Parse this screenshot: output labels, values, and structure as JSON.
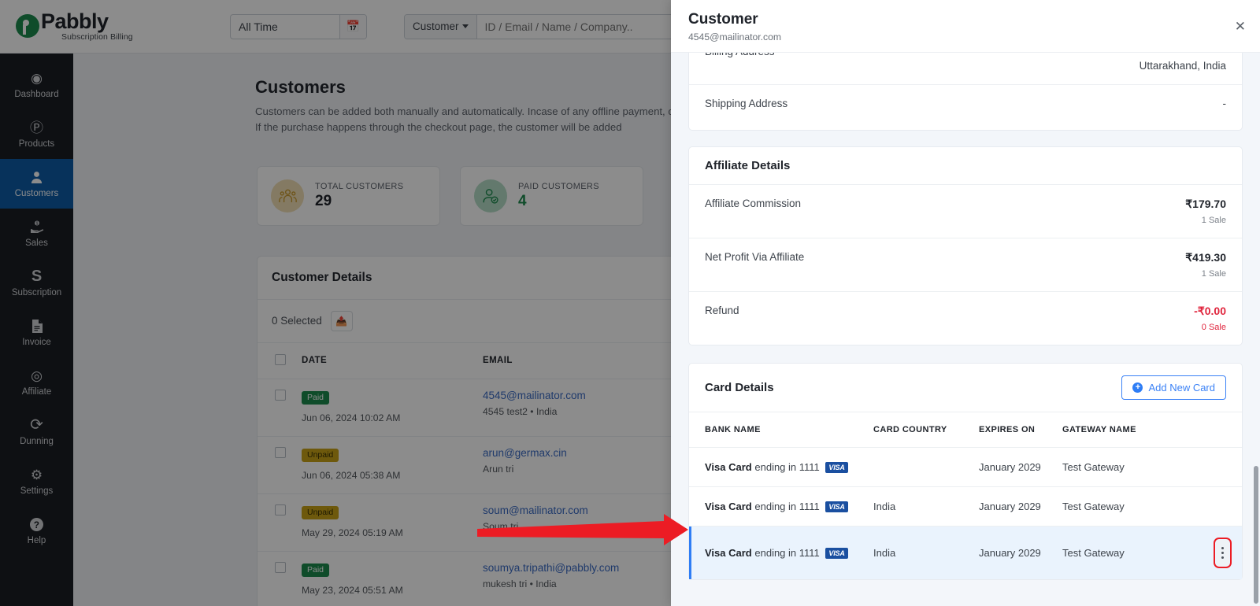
{
  "brand": {
    "name": "Pabbly",
    "subtitle": "Subscription Billing"
  },
  "toolbar": {
    "date_filter_value": "All Time",
    "calendar_icon": "calendar-icon",
    "search_kind": "Customer",
    "search_placeholder": "ID / Email / Name / Company..",
    "search_value": "",
    "search_icon": "search-icon"
  },
  "sidebar": {
    "items": [
      {
        "label": "Dashboard",
        "icon": "speedometer-icon",
        "glyph": "◕",
        "active": false
      },
      {
        "label": "Products",
        "icon": "product-p-icon",
        "glyph": "Ⓟ",
        "active": false
      },
      {
        "label": "Customers",
        "icon": "person-icon",
        "glyph": "👤",
        "active": true
      },
      {
        "label": "Sales",
        "icon": "hand-coin-icon",
        "glyph": "🖐",
        "active": false
      },
      {
        "label": "Subscription",
        "icon": "letter-s-icon",
        "glyph": "S",
        "active": false
      },
      {
        "label": "Invoice",
        "icon": "document-icon",
        "glyph": "📄",
        "active": false
      },
      {
        "label": "Affiliate",
        "icon": "share-node-icon",
        "glyph": "◎",
        "active": false
      },
      {
        "label": "Dunning",
        "icon": "refresh-icon",
        "glyph": "⟳",
        "active": false
      },
      {
        "label": "Settings",
        "icon": "gear-icon",
        "glyph": "⚙",
        "active": false
      },
      {
        "label": "Help",
        "icon": "question-icon",
        "glyph": "?",
        "active": false
      }
    ]
  },
  "page": {
    "title": "Customers",
    "description": "Customers can be added both manually and automatically. Incase of any offline payment, click on th add the customer. If the purchase happens through the checkout page, the customer will be added"
  },
  "stats": [
    {
      "label": "TOTAL CUSTOMERS",
      "value": "29",
      "icon": "people-group-icon",
      "color": "#c99a2e"
    },
    {
      "label": "PAID CUSTOMERS",
      "value": "4",
      "icon": "person-check-icon",
      "color": "#1d8a4e"
    }
  ],
  "customer_table": {
    "title": "Customer Details",
    "selected_text": "0 Selected",
    "export_icon": "export-file-icon",
    "columns": [
      "DATE",
      "EMAIL"
    ],
    "rows": [
      {
        "status": "Paid",
        "date": "Jun 06, 2024 10:02 AM",
        "email": "4545@mailinator.com",
        "name": "4545 test2 • India"
      },
      {
        "status": "Unpaid",
        "date": "Jun 06, 2024 05:38 AM",
        "email": "arun@germax.cin",
        "name": "Arun tri"
      },
      {
        "status": "Unpaid",
        "date": "May 29, 2024 05:19 AM",
        "email": "soum@mailinator.com",
        "name": "Soum tri"
      },
      {
        "status": "Paid",
        "date": "May 23, 2024 05:51 AM",
        "email": "soumya.tripathi@pabbly.com",
        "name": "mukesh tri • India"
      }
    ]
  },
  "drawer": {
    "title": "Customer",
    "subtitle": "4545@mailinator.com",
    "close_icon": "close-icon",
    "address_section": {
      "rows": [
        {
          "key": "Billing Address",
          "value": "Uttarakhand, India"
        },
        {
          "key": "Shipping Address",
          "value": "-"
        }
      ]
    },
    "affiliate_section": {
      "title": "Affiliate Details",
      "rows": [
        {
          "key": "Affiliate Commission",
          "value": "₹179.70",
          "note": "1 Sale",
          "negative": false
        },
        {
          "key": "Net Profit Via Affiliate",
          "value": "₹419.30",
          "note": "1 Sale",
          "negative": false
        },
        {
          "key": "Refund",
          "value": "-₹0.00",
          "note": "0 Sale",
          "negative": true
        }
      ]
    },
    "card_section": {
      "title": "Card Details",
      "add_button": "Add New Card",
      "add_icon": "plus-circle-icon",
      "columns": [
        "BANK NAME",
        "CARD COUNTRY",
        "EXPIRES ON",
        "GATEWAY NAME"
      ],
      "rows": [
        {
          "bank_strong": "Visa Card",
          "bank_rest": "ending in 1111",
          "brand": "VISA",
          "country": "",
          "expires": "January 2029",
          "gateway": "Test Gateway",
          "highlighted": false,
          "menu": false
        },
        {
          "bank_strong": "Visa Card",
          "bank_rest": "ending in 1111",
          "brand": "VISA",
          "country": "India",
          "expires": "January 2029",
          "gateway": "Test Gateway",
          "highlighted": false,
          "menu": false
        },
        {
          "bank_strong": "Visa Card",
          "bank_rest": "ending in 1111",
          "brand": "VISA",
          "country": "India",
          "expires": "January 2029",
          "gateway": "Test Gateway",
          "highlighted": true,
          "menu": true
        }
      ],
      "row_menu_icon": "kebab-menu-icon"
    }
  },
  "annotation": {
    "arrow_color": "#ec1c24",
    "highlight_color": "#ec1c24"
  }
}
